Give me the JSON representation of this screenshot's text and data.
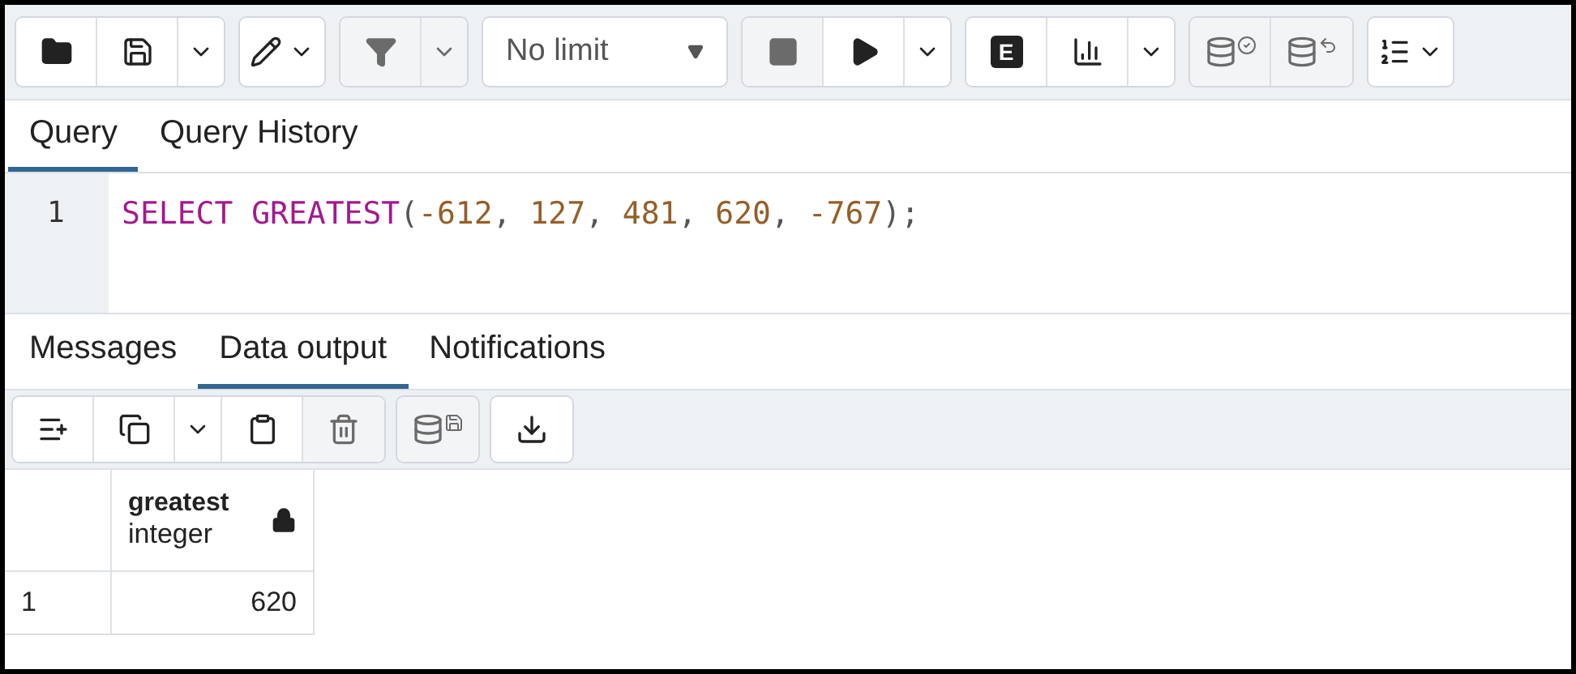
{
  "toolbar": {
    "groups": [
      {
        "buttons": [
          {
            "kind": "folder",
            "disabled": false
          },
          {
            "kind": "save",
            "disabled": false
          },
          {
            "kind": "caret",
            "disabled": false
          }
        ]
      },
      {
        "buttons": [
          {
            "kind": "pen-caret",
            "disabled": false
          }
        ]
      },
      {
        "buttons": [
          {
            "kind": "filter",
            "disabled": true
          },
          {
            "kind": "caret",
            "disabled": true
          }
        ]
      },
      {
        "buttons": [
          {
            "kind": "limit",
            "label": "No limit",
            "disabled": false
          }
        ]
      },
      {
        "buttons": [
          {
            "kind": "stop",
            "disabled": true
          },
          {
            "kind": "play",
            "disabled": false
          },
          {
            "kind": "caret",
            "disabled": false
          }
        ]
      },
      {
        "buttons": [
          {
            "kind": "letter",
            "label": "E",
            "disabled": false
          },
          {
            "kind": "chart",
            "disabled": false
          },
          {
            "kind": "caret",
            "disabled": false
          }
        ]
      },
      {
        "buttons": [
          {
            "kind": "db-check",
            "disabled": true
          },
          {
            "kind": "db-undo",
            "disabled": true
          }
        ]
      },
      {
        "buttons": [
          {
            "kind": "list-caret",
            "disabled": false
          }
        ]
      }
    ]
  },
  "editor_tabs": [
    {
      "label": "Query",
      "selected": true
    },
    {
      "label": "Query History",
      "selected": false
    }
  ],
  "editor": {
    "lines": [
      {
        "number": "1",
        "tokens": [
          {
            "text": "SELECT GREATEST",
            "kind": "keyword"
          },
          {
            "text": "(",
            "kind": "punct"
          },
          {
            "text": "-612",
            "kind": "number"
          },
          {
            "text": ", ",
            "kind": "punct"
          },
          {
            "text": "127",
            "kind": "number"
          },
          {
            "text": ", ",
            "kind": "punct"
          },
          {
            "text": "481",
            "kind": "number"
          },
          {
            "text": ", ",
            "kind": "punct"
          },
          {
            "text": "620",
            "kind": "number"
          },
          {
            "text": ", ",
            "kind": "punct"
          },
          {
            "text": "-767",
            "kind": "number"
          },
          {
            "text": ");",
            "kind": "punct"
          }
        ]
      }
    ]
  },
  "output_tabs": [
    {
      "label": "Messages",
      "selected": false
    },
    {
      "label": "Data output",
      "selected": true
    },
    {
      "label": "Notifications",
      "selected": false
    }
  ],
  "grid_toolbar": {
    "groups": [
      {
        "buttons": [
          {
            "kind": "add-row",
            "disabled": false
          },
          {
            "kind": "copy",
            "disabled": false
          },
          {
            "kind": "caret",
            "disabled": false
          },
          {
            "kind": "paste",
            "disabled": false
          },
          {
            "kind": "delete",
            "disabled": true
          }
        ]
      },
      {
        "buttons": [
          {
            "kind": "db-save",
            "disabled": true
          }
        ]
      },
      {
        "buttons": [
          {
            "kind": "download",
            "disabled": false
          }
        ]
      }
    ]
  },
  "table": {
    "columns": [
      {
        "name": "greatest",
        "type": "integer",
        "locked": true
      }
    ],
    "rows": [
      {
        "number": "1",
        "cells": [
          "620"
        ]
      }
    ]
  }
}
